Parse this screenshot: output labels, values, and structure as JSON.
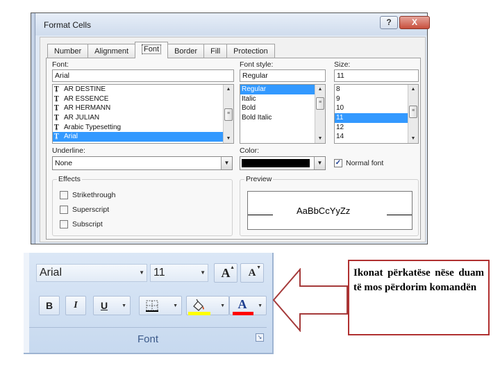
{
  "dialog": {
    "title": "Format Cells",
    "help_label": "?",
    "close_label": "X",
    "tabs": [
      {
        "label": "Number",
        "active": false
      },
      {
        "label": "Alignment",
        "active": false
      },
      {
        "label": "Font",
        "active": true
      },
      {
        "label": "Border",
        "active": false
      },
      {
        "label": "Fill",
        "active": false
      },
      {
        "label": "Protection",
        "active": false
      }
    ],
    "font": {
      "label": "Font:",
      "value": "Arial",
      "items": [
        "AR DESTINE",
        "AR ESSENCE",
        "AR HERMANN",
        "AR JULIAN",
        "Arabic Typesetting",
        "Arial"
      ],
      "selected_index": 5,
      "item_icon": "truetype-icon"
    },
    "font_style": {
      "label": "Font style:",
      "value": "Regular",
      "items": [
        "Regular",
        "Italic",
        "Bold",
        "Bold Italic"
      ],
      "selected_index": 0
    },
    "size": {
      "label": "Size:",
      "value": "11",
      "items": [
        "8",
        "9",
        "10",
        "11",
        "12",
        "14"
      ],
      "selected_index": 3
    },
    "underline": {
      "label": "Underline:",
      "value": "None"
    },
    "color": {
      "label": "Color:",
      "swatch": "#000000"
    },
    "normal_font": {
      "label": "Normal font",
      "checked": true
    },
    "effects": {
      "title": "Effects",
      "items": [
        {
          "label": "Strikethrough",
          "checked": false
        },
        {
          "label": "Superscript",
          "checked": false
        },
        {
          "label": "Subscript",
          "checked": false
        }
      ]
    },
    "preview": {
      "title": "Preview",
      "sample": "AaBbCcYyZz"
    }
  },
  "ribbon": {
    "font_name": "Arial",
    "font_size": "11",
    "grow_font_glyph": "A",
    "shrink_font_glyph": "A",
    "bold_glyph": "B",
    "italic_glyph": "I",
    "underline_glyph": "U",
    "font_color_glyph": "A",
    "fill_color": "#ffff00",
    "font_color": "#ff0000",
    "group_label": "Font"
  },
  "callout": {
    "text": "Ikonat përkatëse nëse duam të mos përdorim komandën",
    "border_color": "#b03030"
  }
}
